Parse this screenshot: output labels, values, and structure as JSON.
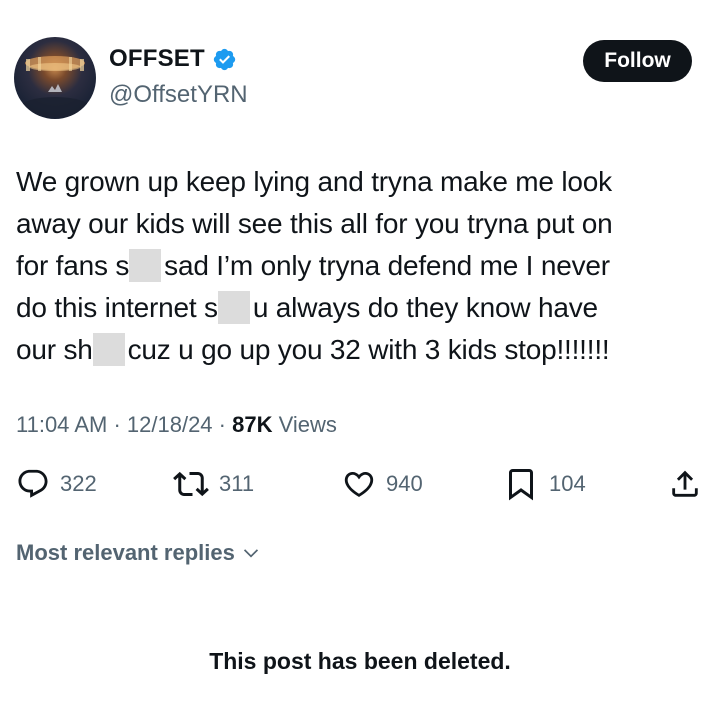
{
  "user": {
    "display_name": "OFFSET",
    "handle": "@OffsetYRN",
    "verified": true,
    "verified_color": "#1d9bf0"
  },
  "follow_button": {
    "label": "Follow"
  },
  "tweet": {
    "lines": [
      {
        "text": "We grown up keep lying and tryna make me look"
      },
      {
        "text": "away our kids will see this all for you tryna put on"
      },
      {
        "before": "for fans s",
        "after": "sad I’m only tryna defend me I never"
      },
      {
        "before": "do this internet s",
        "after": "u always do they know have"
      },
      {
        "before": "our sh",
        "after": "cuz u go up you 32 with 3 kids stop!!!!!!!"
      }
    ],
    "time": "11:04 AM",
    "separator": "·",
    "date": "12/18/24",
    "views_count": "87K",
    "views_label": "Views"
  },
  "actions": {
    "replies": {
      "icon": "reply-icon",
      "count": "322"
    },
    "reposts": {
      "icon": "repost-icon",
      "count": "311"
    },
    "likes": {
      "icon": "heart-icon",
      "count": "940"
    },
    "bookmarks": {
      "icon": "bookmark-icon",
      "count": "104"
    },
    "share": {
      "icon": "share-icon"
    }
  },
  "replies_filter": {
    "label": "Most relevant replies",
    "icon": "chevron-down-icon"
  },
  "deleted_notice": "This post has been deleted."
}
